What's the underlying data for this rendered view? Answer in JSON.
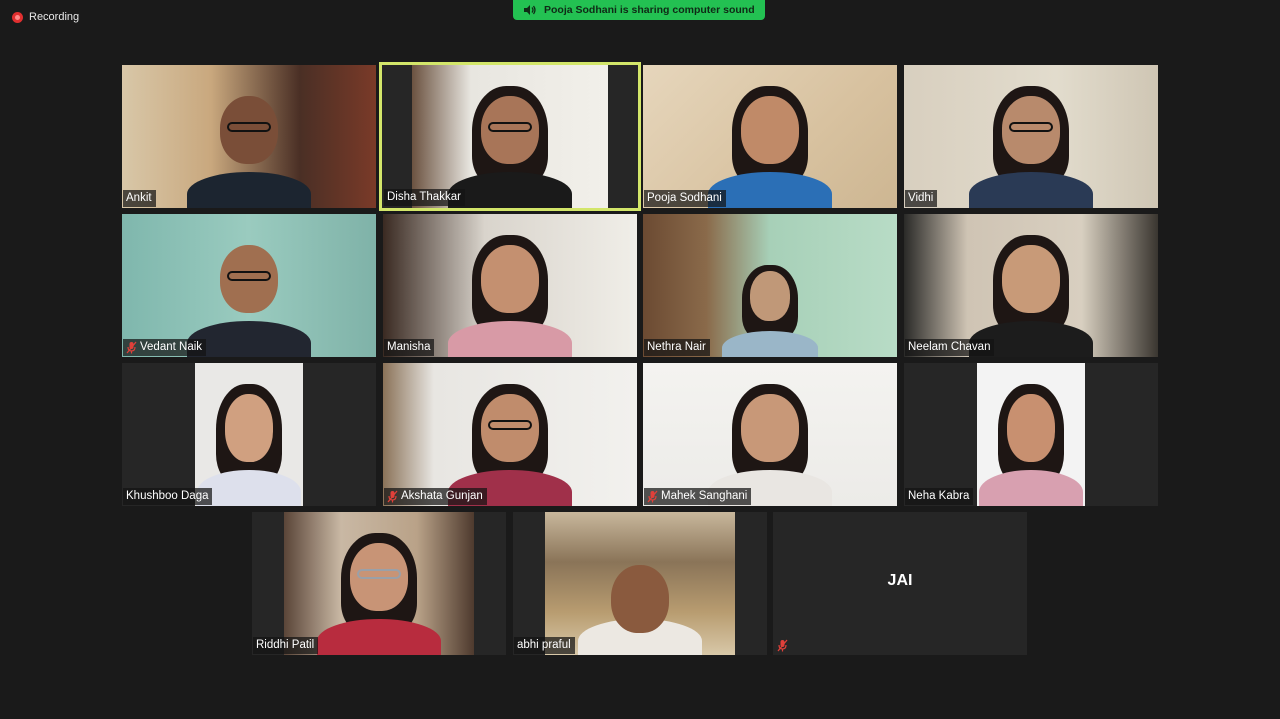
{
  "recording": {
    "label": "Recording"
  },
  "banner": {
    "text": "Pooja Sodhani is sharing computer sound"
  },
  "participants": [
    {
      "name": "Ankit",
      "muted": false
    },
    {
      "name": "Disha Thakkar",
      "muted": false
    },
    {
      "name": "Pooja Sodhani",
      "muted": false
    },
    {
      "name": "Vidhi",
      "muted": false
    },
    {
      "name": "Vedant Naik",
      "muted": true
    },
    {
      "name": "Manisha",
      "muted": false
    },
    {
      "name": "Nethra Nair",
      "muted": false
    },
    {
      "name": "Neelam Chavan",
      "muted": false
    },
    {
      "name": "Khushboo Daga",
      "muted": false
    },
    {
      "name": "Akshata Gunjan",
      "muted": true
    },
    {
      "name": "Mahek Sanghani",
      "muted": true
    },
    {
      "name": "Neha Kabra",
      "muted": false
    },
    {
      "name": "Riddhi Patil",
      "muted": false
    },
    {
      "name": "abhi praful",
      "muted": false
    },
    {
      "name": "",
      "avatar_text": "JAI",
      "muted": true
    }
  ],
  "colors": {
    "background": "#1a1a1a",
    "active_speaker_border": "#d3e66a",
    "banner": "#23c152",
    "mute_icon": "#e0403a"
  }
}
